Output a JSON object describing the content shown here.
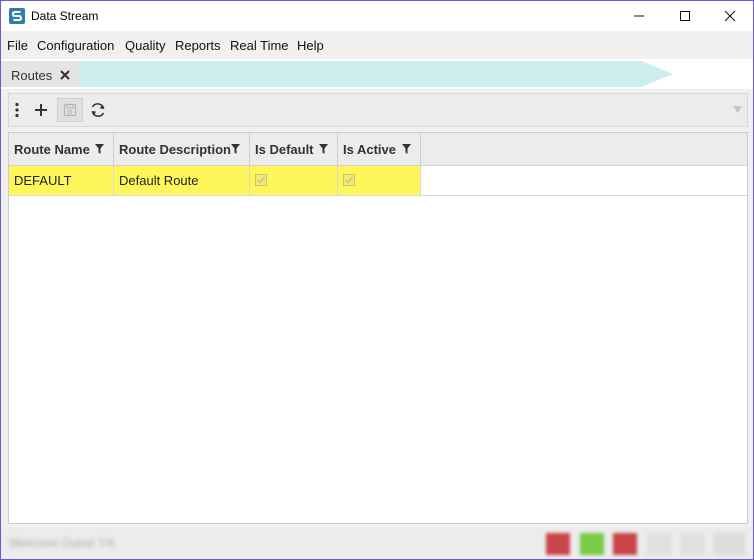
{
  "window": {
    "title": "Data Stream",
    "controls": [
      "minimize",
      "maximize",
      "close"
    ]
  },
  "menu": {
    "items": [
      "File",
      "Configuration",
      "Quality",
      "Reports",
      "Real Time",
      "Help"
    ]
  },
  "tabs": [
    {
      "label": "Routes",
      "active": true,
      "closable": true
    }
  ],
  "toolbar": {
    "buttons": [
      "more-vertical-icon",
      "add-icon",
      "save-icon",
      "refresh-icon"
    ],
    "dropdown": "chevron-down-icon"
  },
  "grid": {
    "columns": [
      {
        "label": "Route Name"
      },
      {
        "label": "Route Description"
      },
      {
        "label": "Is Default"
      },
      {
        "label": "Is Active"
      }
    ],
    "rows": [
      {
        "route_name": "DEFAULT",
        "route_description": "Default Route",
        "is_default": true,
        "is_active": true,
        "highlighted": true
      }
    ]
  },
  "status": {
    "text": "Welcome Guest 7/4",
    "indicator_colors": [
      "#c8454a",
      "#7cc94a",
      "#c8454a"
    ]
  },
  "colors": {
    "row_highlight": "#fff65a",
    "tab_accent": "#cdeeee",
    "window_border": "#6a5acd"
  }
}
